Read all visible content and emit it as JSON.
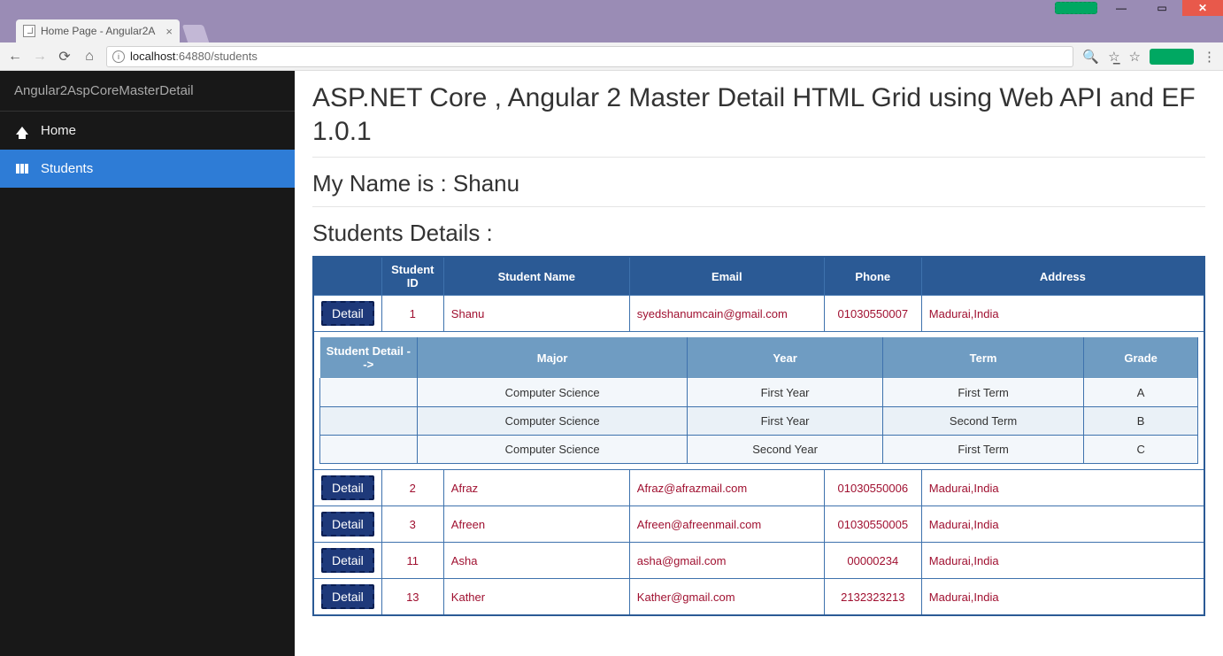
{
  "window": {
    "tab_title": "Home Page - Angular2A",
    "url_host": "localhost",
    "url_port": ":64880",
    "url_path": "/students"
  },
  "sidebar": {
    "brand": "Angular2AspCoreMasterDetail",
    "items": [
      {
        "label": "Home",
        "icon": "home-icon",
        "active": false
      },
      {
        "label": "Students",
        "icon": "grid-icon",
        "active": true
      }
    ]
  },
  "page": {
    "title": "ASP.NET Core , Angular 2 Master Detail HTML Grid using Web API and EF 1.0.1",
    "name_line_prefix": "My Name is : ",
    "name_value": "Shanu",
    "section_heading": "Students Details :"
  },
  "master": {
    "detail_button_label": "Detail",
    "headers": [
      "Student ID",
      "Student Name",
      "Email",
      "Phone",
      "Address"
    ],
    "rows": [
      {
        "id": "1",
        "name": "Shanu",
        "email": "syedshanumcain@gmail.com",
        "phone": "01030550007",
        "address": "Madurai,India",
        "expanded": true
      },
      {
        "id": "2",
        "name": "Afraz",
        "email": "Afraz@afrazmail.com",
        "phone": "01030550006",
        "address": "Madurai,India",
        "expanded": false
      },
      {
        "id": "3",
        "name": "Afreen",
        "email": "Afreen@afreenmail.com",
        "phone": "01030550005",
        "address": "Madurai,India",
        "expanded": false
      },
      {
        "id": "11",
        "name": "Asha",
        "email": "asha@gmail.com",
        "phone": "00000234",
        "address": "Madurai,India",
        "expanded": false
      },
      {
        "id": "13",
        "name": "Kather",
        "email": "Kather@gmail.com",
        "phone": "2132323213",
        "address": "Madurai,India",
        "expanded": false
      }
    ]
  },
  "detail": {
    "headers": [
      "Student Detail -->",
      "Major",
      "Year",
      "Term",
      "Grade"
    ],
    "rows": [
      {
        "major": "Computer Science",
        "year": "First Year",
        "term": "First Term",
        "grade": "A"
      },
      {
        "major": "Computer Science",
        "year": "First Year",
        "term": "Second Term",
        "grade": "B"
      },
      {
        "major": "Computer Science",
        "year": "Second Year",
        "term": "First Term",
        "grade": "C"
      }
    ]
  }
}
